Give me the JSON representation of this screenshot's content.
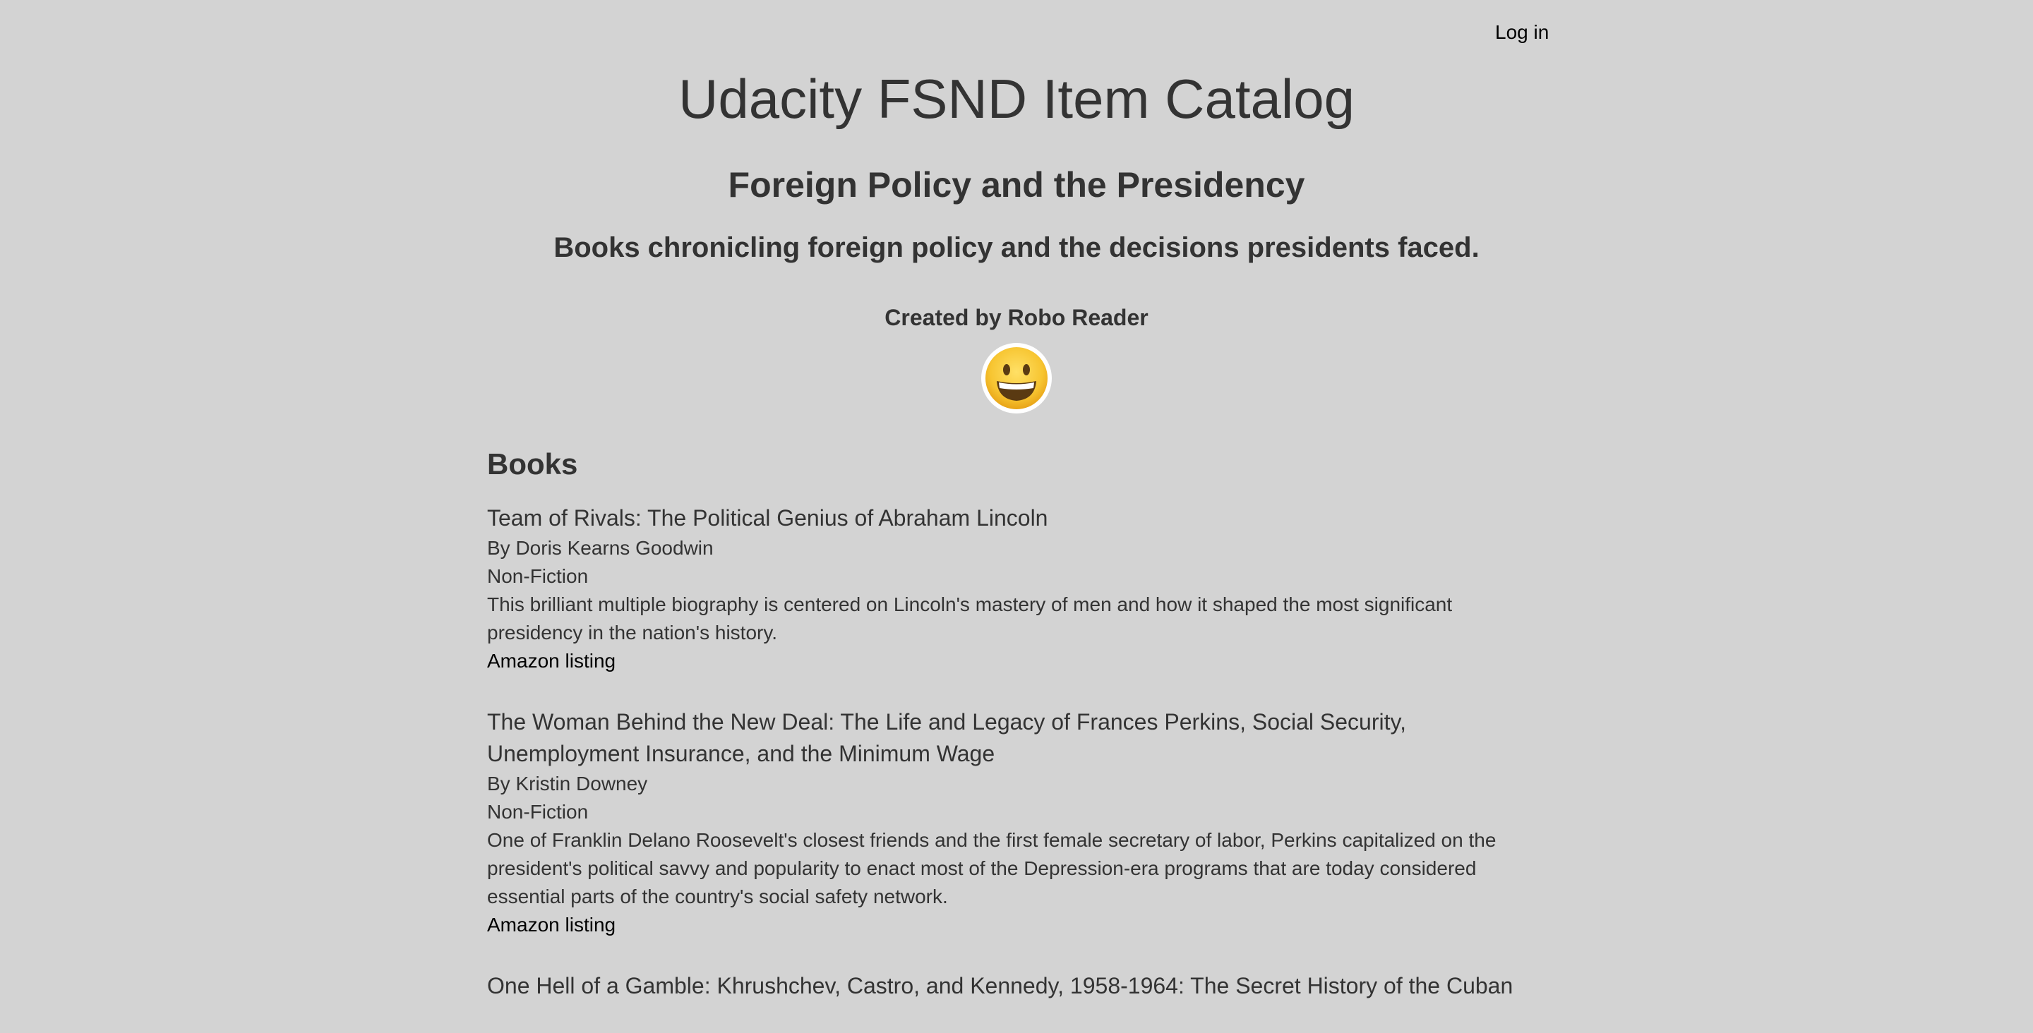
{
  "nav": {
    "login_label": "Log in"
  },
  "header": {
    "app_title": "Udacity FSND Item Catalog",
    "category_title": "Foreign Policy and the Presidency",
    "category_description": "Books chronicling foreign policy and the decisions presidents faced.",
    "creator_text": "Created by Robo Reader",
    "avatar_icon": "grinning-face-icon"
  },
  "books_section": {
    "heading": "Books",
    "items": [
      {
        "title": "Team of Rivals: The Political Genius of Abraham Lincoln",
        "author": "By Doris Kearns Goodwin",
        "genre": "Non-Fiction",
        "description": "This brilliant multiple biography is centered on Lincoln's mastery of men and how it shaped the most significant presidency in the nation's history.",
        "link_label": "Amazon listing"
      },
      {
        "title": "The Woman Behind the New Deal: The Life and Legacy of Frances Perkins, Social Security, Unemployment Insurance, and the Minimum Wage",
        "author": "By Kristin Downey",
        "genre": "Non-Fiction",
        "description": "One of Franklin Delano Roosevelt's closest friends and the first female secretary of labor, Perkins capitalized on the president's political savvy and popularity to enact most of the Depression-era programs that are today considered essential parts of the country's social safety network.",
        "link_label": "Amazon listing"
      },
      {
        "title": "One Hell of a Gamble: Khrushchev, Castro, and Kennedy, 1958-1964: The Secret History of the Cuban"
      }
    ]
  },
  "colors": {
    "background": "#d3d3d3",
    "text": "#333333",
    "link": "#000000"
  }
}
